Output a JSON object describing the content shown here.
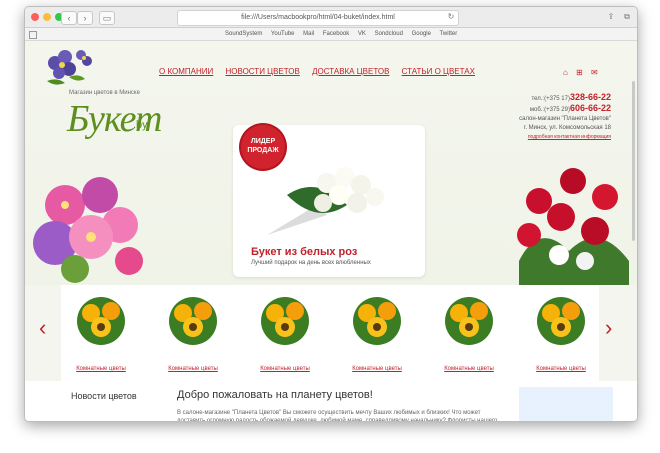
{
  "browser": {
    "url": "file:///Users/macbookpro/html/04-buket/index.html",
    "favorites": [
      "SoundSystem",
      "YouTube",
      "Mail",
      "Facebook",
      "VK",
      "Sondcloud",
      "Google",
      "Twitter"
    ]
  },
  "logo": {
    "tagline": "Магазин цветов в Минске",
    "word": "Букет",
    "suffix": ".by"
  },
  "nav": [
    "О КОМПАНИИ",
    "НОВОСТИ ЦВЕТОВ",
    "ДОСТАВКА ЦВЕТОВ",
    "СТАТЬИ О ЦВЕТАХ"
  ],
  "header_icons": [
    "home-icon",
    "sitemap-icon",
    "contact-icon"
  ],
  "contacts": {
    "tel_prefix": "тел.:(+375 17)",
    "tel_number": "328-66-22",
    "mob_prefix": "моб.:(+375 29)",
    "mob_number": "606-66-22",
    "salon": "салон-магазин \"Планета Цветов\"",
    "address": "г. Минск, ул. Комсомольская 18",
    "more_link": "подробная контактная информация"
  },
  "promo": {
    "badge_line1": "ЛИДЕР",
    "badge_line2": "ПРОДАЖ",
    "title": "Букет из белых роз",
    "subtitle": "Лучший подарок на день всех влюбленных"
  },
  "carousel": {
    "items": [
      "Комнатные цветы",
      "Комнатные цветы",
      "Комнатные цветы",
      "Комнатные цветы",
      "Комнатные цветы",
      "Комнатные цветы"
    ]
  },
  "content": {
    "news_heading": "Новости цветов",
    "welcome_heading": "Добро пожаловать на планету цветов!",
    "welcome_text": "В салоне-магазине \"Планета Цветов\" Вы сможете осуществить мечту Ваших любимых и близких! Что может доставить огромную радость обожаемой девушке, любимой маме, справедливому начальнику? Флористы нашего салона воплотят в"
  },
  "colors": {
    "accent": "#c0212b",
    "logo_green": "#5c8f1f"
  }
}
